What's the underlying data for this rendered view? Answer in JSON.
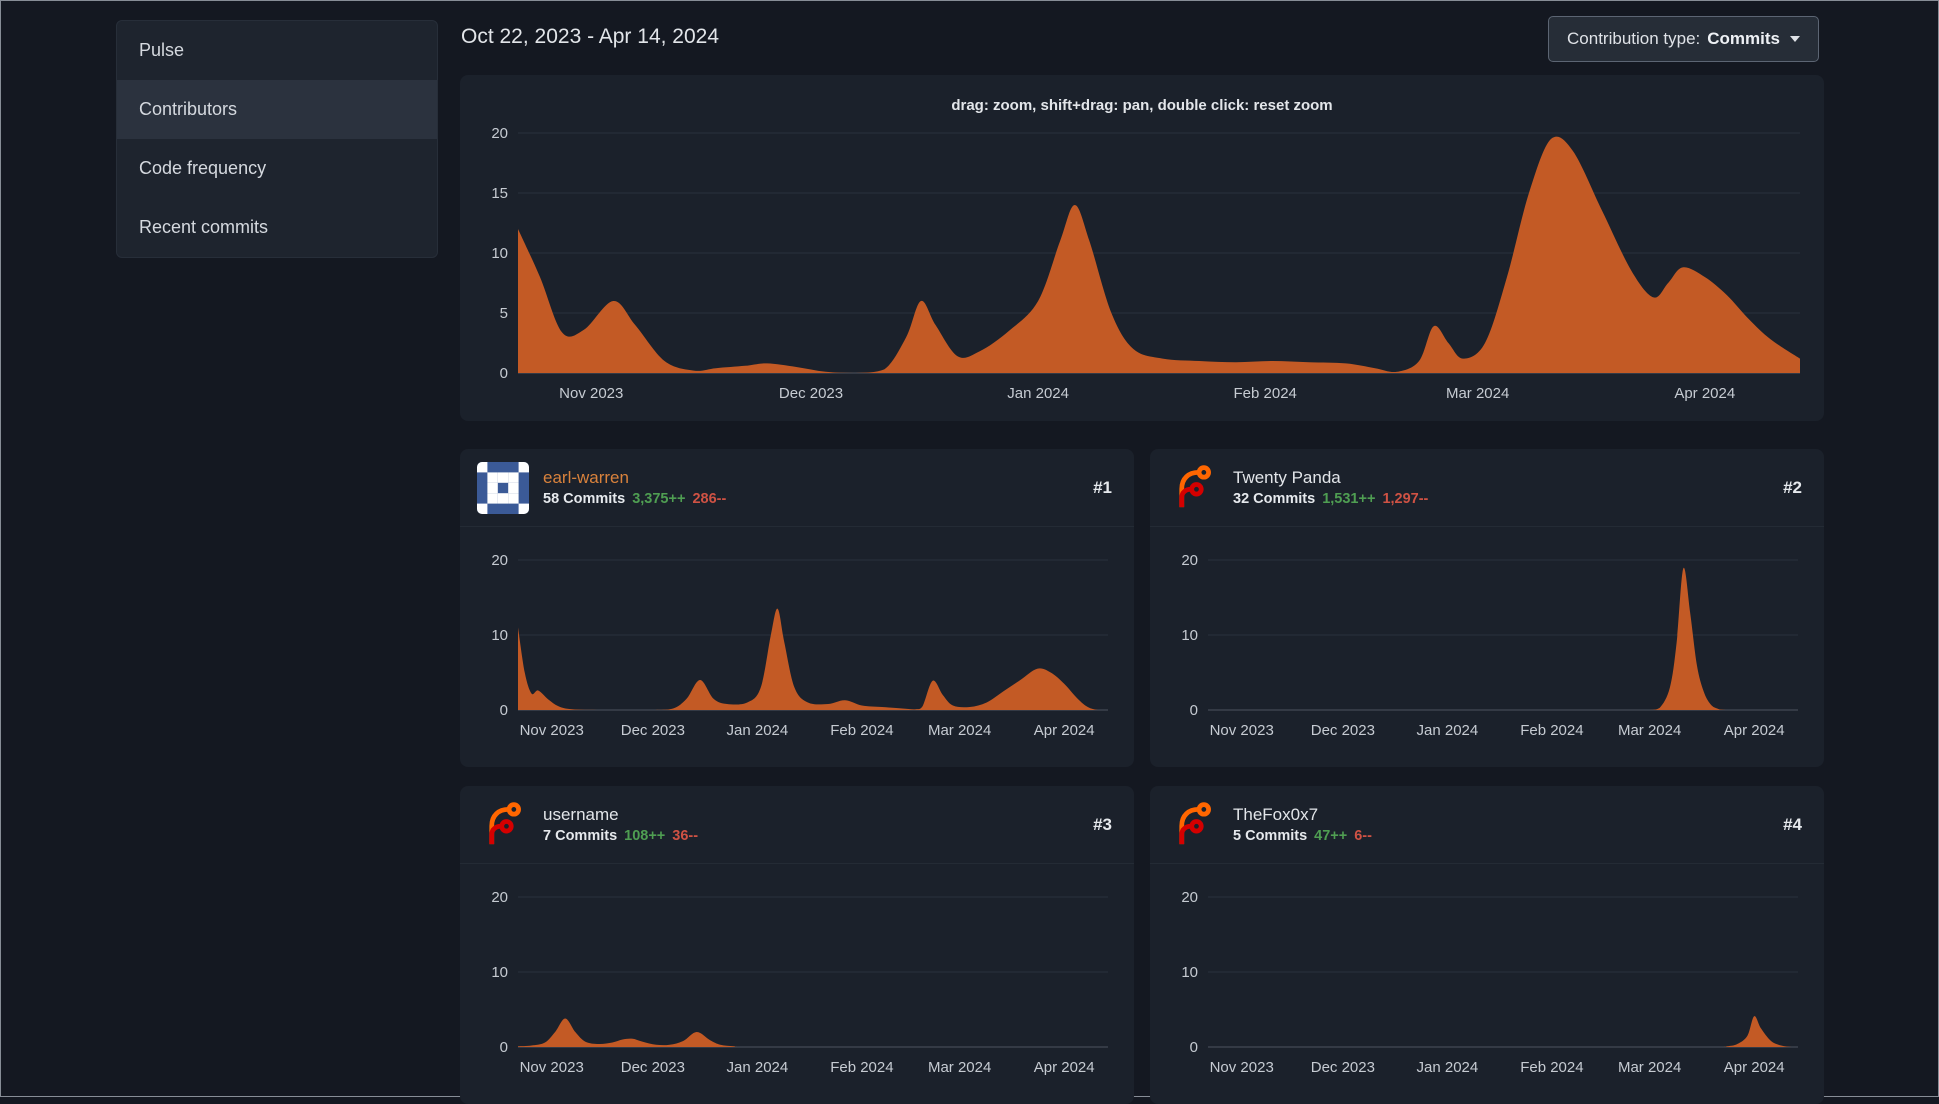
{
  "theme": {
    "accent": "#c35a25",
    "green": "#4f9e52",
    "red": "#cf5244",
    "page_bg": "#141821",
    "card_bg": "#1b212b"
  },
  "sidebar": {
    "active": "Contributors",
    "items": [
      {
        "label": "Pulse"
      },
      {
        "label": "Contributors"
      },
      {
        "label": "Code frequency"
      },
      {
        "label": "Recent commits"
      }
    ]
  },
  "header": {
    "date_range": "Oct 22, 2023 - Apr 14, 2024",
    "contribution_type": {
      "label": "Contribution type:",
      "value": "Commits"
    }
  },
  "main_chart": {
    "hint": "drag: zoom, shift+drag: pan, double click: reset zoom",
    "chart": {
      "type": "area",
      "color": "#c35a25",
      "ylim": [
        0,
        20
      ],
      "yticks": [
        0,
        5,
        10,
        15,
        20
      ],
      "x_domain_days": [
        0,
        175
      ],
      "x_labels": [
        {
          "label": "Nov 2023",
          "day": 10
        },
        {
          "label": "Dec 2023",
          "day": 40
        },
        {
          "label": "Jan 2024",
          "day": 71
        },
        {
          "label": "Feb 2024",
          "day": 102
        },
        {
          "label": "Mar 2024",
          "day": 131
        },
        {
          "label": "Apr 2024",
          "day": 162
        }
      ],
      "points": [
        [
          0,
          12
        ],
        [
          3,
          8
        ],
        [
          6,
          3.4
        ],
        [
          9,
          3.6
        ],
        [
          13,
          6
        ],
        [
          16,
          4
        ],
        [
          20,
          1
        ],
        [
          24,
          0.2
        ],
        [
          27,
          0.4
        ],
        [
          31,
          0.6
        ],
        [
          34,
          0.8
        ],
        [
          38,
          0.5
        ],
        [
          42,
          0.1
        ],
        [
          46,
          0
        ],
        [
          50,
          0.3
        ],
        [
          53,
          3
        ],
        [
          55,
          6
        ],
        [
          57,
          4
        ],
        [
          60,
          1.4
        ],
        [
          63,
          1.8
        ],
        [
          67,
          3.5
        ],
        [
          71,
          6
        ],
        [
          74,
          11
        ],
        [
          76,
          14
        ],
        [
          78,
          11
        ],
        [
          81,
          5
        ],
        [
          84,
          2
        ],
        [
          88,
          1.2
        ],
        [
          93,
          1
        ],
        [
          98,
          0.9
        ],
        [
          103,
          1
        ],
        [
          108,
          0.9
        ],
        [
          113,
          0.8
        ],
        [
          117,
          0.4
        ],
        [
          120,
          0.1
        ],
        [
          123,
          1
        ],
        [
          125,
          3.9
        ],
        [
          127,
          2.5
        ],
        [
          129,
          1.2
        ],
        [
          132,
          2.5
        ],
        [
          135,
          8
        ],
        [
          138,
          15
        ],
        [
          141,
          19.5
        ],
        [
          144,
          18.5
        ],
        [
          148,
          13.5
        ],
        [
          152,
          8.5
        ],
        [
          155,
          6.3
        ],
        [
          157,
          7.5
        ],
        [
          159,
          8.8
        ],
        [
          162,
          8
        ],
        [
          165,
          6.5
        ],
        [
          168,
          4.5
        ],
        [
          171,
          2.8
        ],
        [
          175,
          1.2
        ]
      ]
    }
  },
  "cards": [
    {
      "name": "earl-warren",
      "name_color": "#d9823c",
      "rank": "#1",
      "commits": "58 Commits",
      "additions": "3,375++",
      "deletions": "286--",
      "avatar": {
        "type": "identicon",
        "bg": "#3b5a97",
        "fg": "#ffffff",
        "pattern": [
          [
            1,
            0,
            0,
            0,
            1
          ],
          [
            0,
            1,
            1,
            1,
            0
          ],
          [
            0,
            1,
            0,
            1,
            0
          ],
          [
            0,
            1,
            1,
            1,
            0
          ],
          [
            1,
            0,
            0,
            0,
            1
          ]
        ]
      },
      "chart": {
        "type": "area",
        "color": "#c35a25",
        "ylim": [
          0,
          20
        ],
        "yticks": [
          0,
          10,
          20
        ],
        "x_domain_days": [
          0,
          175
        ],
        "x_labels": [
          {
            "label": "Nov 2023",
            "day": 10
          },
          {
            "label": "Dec 2023",
            "day": 40
          },
          {
            "label": "Jan 2024",
            "day": 71
          },
          {
            "label": "Feb 2024",
            "day": 102
          },
          {
            "label": "Mar 2024",
            "day": 131
          },
          {
            "label": "Apr 2024",
            "day": 162
          }
        ],
        "points": [
          [
            0,
            11
          ],
          [
            2,
            5
          ],
          [
            4,
            2.2
          ],
          [
            6,
            2.6
          ],
          [
            9,
            1.4
          ],
          [
            12,
            0.5
          ],
          [
            16,
            0.1
          ],
          [
            25,
            0
          ],
          [
            40,
            0
          ],
          [
            46,
            0.2
          ],
          [
            50,
            1.5
          ],
          [
            54,
            4
          ],
          [
            58,
            1.5
          ],
          [
            62,
            0.8
          ],
          [
            68,
            1
          ],
          [
            72,
            3
          ],
          [
            75,
            10
          ],
          [
            77,
            13.5
          ],
          [
            79,
            9
          ],
          [
            82,
            3
          ],
          [
            86,
            1
          ],
          [
            92,
            0.8
          ],
          [
            97,
            1.3
          ],
          [
            102,
            0.6
          ],
          [
            108,
            0.4
          ],
          [
            114,
            0.2
          ],
          [
            118,
            0.1
          ],
          [
            120,
            0.5
          ],
          [
            123,
            3.9
          ],
          [
            126,
            2
          ],
          [
            129,
            0.6
          ],
          [
            134,
            0.4
          ],
          [
            139,
            1
          ],
          [
            144,
            2.5
          ],
          [
            149,
            4
          ],
          [
            154,
            5.5
          ],
          [
            158,
            5
          ],
          [
            162,
            3.5
          ],
          [
            166,
            1.5
          ],
          [
            169,
            0.4
          ],
          [
            172,
            0
          ],
          [
            175,
            0
          ]
        ]
      }
    },
    {
      "name": "Twenty Panda",
      "rank": "#2",
      "commits": "32 Commits",
      "additions": "1,531++",
      "deletions": "1,297--",
      "avatar": {
        "type": "forgejo-logo"
      },
      "chart": {
        "type": "area",
        "color": "#c35a25",
        "ylim": [
          0,
          20
        ],
        "yticks": [
          0,
          10,
          20
        ],
        "x_domain_days": [
          0,
          175
        ],
        "x_labels": [
          {
            "label": "Nov 2023",
            "day": 10
          },
          {
            "label": "Dec 2023",
            "day": 40
          },
          {
            "label": "Jan 2024",
            "day": 71
          },
          {
            "label": "Feb 2024",
            "day": 102
          },
          {
            "label": "Mar 2024",
            "day": 131
          },
          {
            "label": "Apr 2024",
            "day": 162
          }
        ],
        "points": [
          [
            0,
            0
          ],
          [
            60,
            0
          ],
          [
            100,
            0
          ],
          [
            125,
            0
          ],
          [
            131,
            0
          ],
          [
            134,
            0.3
          ],
          [
            137,
            3
          ],
          [
            139,
            9
          ],
          [
            141,
            18.9
          ],
          [
            143,
            13
          ],
          [
            145,
            6
          ],
          [
            147,
            2.5
          ],
          [
            149,
            0.8
          ],
          [
            151,
            0.2
          ],
          [
            154,
            0
          ],
          [
            165,
            0
          ],
          [
            175,
            0
          ]
        ]
      }
    },
    {
      "name": "username",
      "rank": "#3",
      "commits": "7 Commits",
      "additions": "108++",
      "deletions": "36--",
      "avatar": {
        "type": "forgejo-logo"
      },
      "chart": {
        "type": "area",
        "color": "#c35a25",
        "ylim": [
          0,
          20
        ],
        "yticks": [
          0,
          10,
          20
        ],
        "x_domain_days": [
          0,
          175
        ],
        "x_labels": [
          {
            "label": "Nov 2023",
            "day": 10
          },
          {
            "label": "Dec 2023",
            "day": 40
          },
          {
            "label": "Jan 2024",
            "day": 71
          },
          {
            "label": "Feb 2024",
            "day": 102
          },
          {
            "label": "Mar 2024",
            "day": 131
          },
          {
            "label": "Apr 2024",
            "day": 162
          }
        ],
        "points": [
          [
            0,
            0.1
          ],
          [
            4,
            0.2
          ],
          [
            8,
            0.6
          ],
          [
            11,
            2
          ],
          [
            14,
            3.8
          ],
          [
            17,
            2
          ],
          [
            20,
            0.7
          ],
          [
            24,
            0.4
          ],
          [
            28,
            0.6
          ],
          [
            31,
            1
          ],
          [
            34,
            1.1
          ],
          [
            37,
            0.7
          ],
          [
            41,
            0.3
          ],
          [
            45,
            0.3
          ],
          [
            49,
            0.8
          ],
          [
            53,
            2
          ],
          [
            57,
            0.9
          ],
          [
            60,
            0.3
          ],
          [
            64,
            0.1
          ],
          [
            68,
            0
          ],
          [
            100,
            0
          ],
          [
            140,
            0
          ],
          [
            175,
            0
          ]
        ]
      }
    },
    {
      "name": "TheFox0x7",
      "rank": "#4",
      "commits": "5 Commits",
      "additions": "47++",
      "deletions": "6--",
      "avatar": {
        "type": "forgejo-logo"
      },
      "chart": {
        "type": "area",
        "color": "#c35a25",
        "ylim": [
          0,
          20
        ],
        "yticks": [
          0,
          10,
          20
        ],
        "x_domain_days": [
          0,
          175
        ],
        "x_labels": [
          {
            "label": "Nov 2023",
            "day": 10
          },
          {
            "label": "Dec 2023",
            "day": 40
          },
          {
            "label": "Jan 2024",
            "day": 71
          },
          {
            "label": "Feb 2024",
            "day": 102
          },
          {
            "label": "Mar 2024",
            "day": 131
          },
          {
            "label": "Apr 2024",
            "day": 162
          }
        ],
        "points": [
          [
            0,
            0
          ],
          [
            80,
            0
          ],
          [
            120,
            0
          ],
          [
            150,
            0
          ],
          [
            154,
            0.1
          ],
          [
            157,
            0.4
          ],
          [
            160,
            1.5
          ],
          [
            162,
            4.1
          ],
          [
            164,
            2.5
          ],
          [
            167,
            0.8
          ],
          [
            170,
            0.2
          ],
          [
            173,
            0
          ],
          [
            175,
            0
          ]
        ]
      }
    }
  ]
}
